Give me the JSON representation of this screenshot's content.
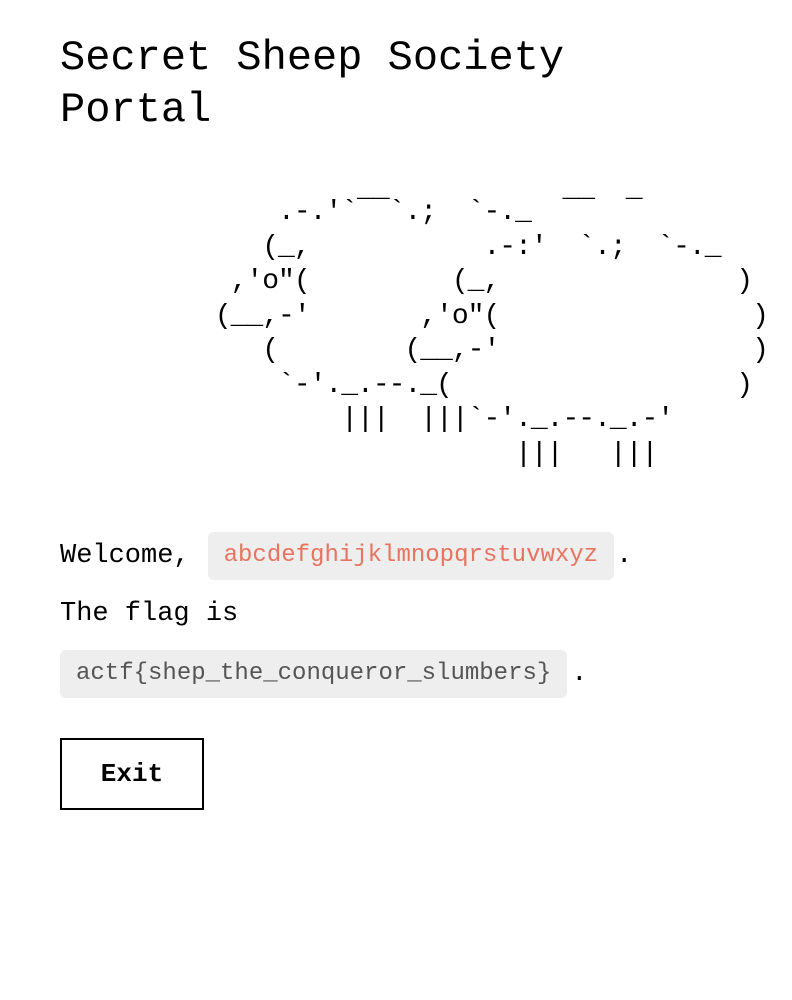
{
  "page": {
    "title": "Secret Sheep Society Portal"
  },
  "art": {
    "icon": "sheep-ascii-art",
    "text": "          .-.'`‾‾`.;  `-._  ‾‾  ‾\n         (_,           .-:'  `.;  `-._\n       ,'o\"(         (_,               )\n      (__,-'       ,'o\"(                )\n         (        (__,-'                )\n          `-'._.--._(                  )\n              |||  |||`-'._.--._.-'\n                         |||   |||"
  },
  "welcome": {
    "prefix": "Welcome,",
    "username": "abcdefghijklmnopqrstuvwxyz",
    "suffix": "."
  },
  "flag": {
    "intro": "The flag is",
    "value": "actf{shep_the_conqueror_slumbers}",
    "suffix": "."
  },
  "actions": {
    "exit_label": "Exit"
  },
  "colors": {
    "username_text": "#e8735f",
    "chip_background": "#eeeeee",
    "flag_text": "#555555"
  }
}
